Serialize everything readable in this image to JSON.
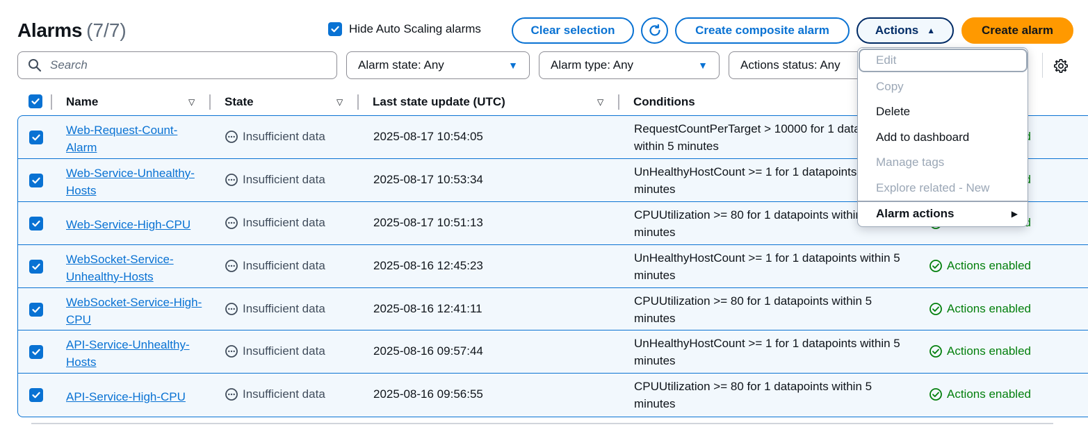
{
  "header": {
    "title": "Alarms",
    "count": "(7/7)"
  },
  "toolbar": {
    "hide_autoscaling_label": "Hide Auto Scaling alarms",
    "hide_autoscaling_checked": true,
    "clear_selection": "Clear selection",
    "refresh_icon": "refresh-icon",
    "create_composite": "Create composite alarm",
    "actions": "Actions",
    "create_alarm": "Create alarm"
  },
  "filters": {
    "search_placeholder": "Search",
    "alarm_state": "Alarm state: Any",
    "alarm_type": "Alarm type: Any",
    "actions_status": "Actions status: Any"
  },
  "table": {
    "headers": {
      "name": "Name",
      "state": "State",
      "last_update": "Last state update (UTC)",
      "conditions": "Conditions"
    },
    "rows": [
      {
        "name": "Web-Request-Count-Alarm",
        "state": "Insufficient data",
        "updated": "2025-08-17 10:54:05",
        "conditions": "RequestCountPerTarget > 10000 for 1 datapoints within 5 minutes",
        "actions": "Actions enabled"
      },
      {
        "name": "Web-Service-Unhealthy-Hosts",
        "state": "Insufficient data",
        "updated": "2025-08-17 10:53:34",
        "conditions": "UnHealthyHostCount >= 1 for 1 datapoints within 5 minutes",
        "actions": "Actions enabled"
      },
      {
        "name": "Web-Service-High-CPU",
        "state": "Insufficient data",
        "updated": "2025-08-17 10:51:13",
        "conditions": "CPUUtilization >= 80 for 1 datapoints within 5 minutes",
        "actions": "Actions enabled"
      },
      {
        "name": "WebSocket-Service-Unhealthy-Hosts",
        "state": "Insufficient data",
        "updated": "2025-08-16 12:45:23",
        "conditions": "UnHealthyHostCount >= 1 for 1 datapoints within 5 minutes",
        "actions": "Actions enabled"
      },
      {
        "name": "WebSocket-Service-High-CPU",
        "state": "Insufficient data",
        "updated": "2025-08-16 12:41:11",
        "conditions": "CPUUtilization >= 80 for 1 datapoints within 5 minutes",
        "actions": "Actions enabled"
      },
      {
        "name": "API-Service-Unhealthy-Hosts",
        "state": "Insufficient data",
        "updated": "2025-08-16 09:57:44",
        "conditions": "UnHealthyHostCount >= 1 for 1 datapoints within 5 minutes",
        "actions": "Actions enabled"
      },
      {
        "name": "API-Service-High-CPU",
        "state": "Insufficient data",
        "updated": "2025-08-16 09:56:55",
        "conditions": "CPUUtilization >= 80 for 1 datapoints within 5 minutes",
        "actions": "Actions enabled"
      }
    ]
  },
  "actions_menu": {
    "items": [
      {
        "label": "Edit",
        "disabled": true
      },
      {
        "label": "Copy",
        "disabled": true
      },
      {
        "label": "Delete",
        "disabled": false
      },
      {
        "label": "Add to dashboard",
        "disabled": false
      },
      {
        "label": "Manage tags",
        "disabled": true
      },
      {
        "label": "Explore related - New",
        "disabled": true
      }
    ],
    "submenu": "Alarm actions"
  },
  "colors": {
    "accent": "#0972d3",
    "primary": "#ff9900",
    "success": "#037f0c",
    "selected_bg": "#f2f8fd"
  }
}
